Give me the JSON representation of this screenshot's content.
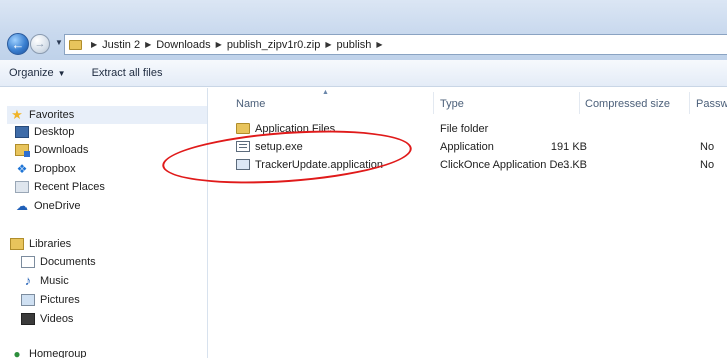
{
  "address": {
    "crumbs": [
      "Justin 2",
      "Downloads",
      "publish_zipv1r0.zip",
      "publish"
    ]
  },
  "toolbar": {
    "organize_label": "Organize",
    "extract_label": "Extract all files"
  },
  "nav": {
    "favorites_label": "Favorites",
    "desktop_label": "Desktop",
    "downloads_label": "Downloads",
    "dropbox_label": "Dropbox",
    "recent_label": "Recent Places",
    "onedrive_label": "OneDrive",
    "libraries_label": "Libraries",
    "documents_label": "Documents",
    "music_label": "Music",
    "pictures_label": "Pictures",
    "videos_label": "Videos",
    "homegroup_label": "Homegroup"
  },
  "columns": {
    "name": "Name",
    "type": "Type",
    "compressed_size": "Compressed size",
    "password": "Passw"
  },
  "files": [
    {
      "name": "Application Files",
      "type": "File folder",
      "size": "",
      "password": "",
      "icon": "folder-icon"
    },
    {
      "name": "setup.exe",
      "type": "Application",
      "size": "191 KB",
      "password": "No",
      "icon": "exe-icon"
    },
    {
      "name": "TrackerUpdate.application",
      "type": "ClickOnce Application De...",
      "size": "3 KB",
      "password": "No",
      "icon": "application-manifest-icon"
    }
  ],
  "highlight_color": "#e01a1a"
}
